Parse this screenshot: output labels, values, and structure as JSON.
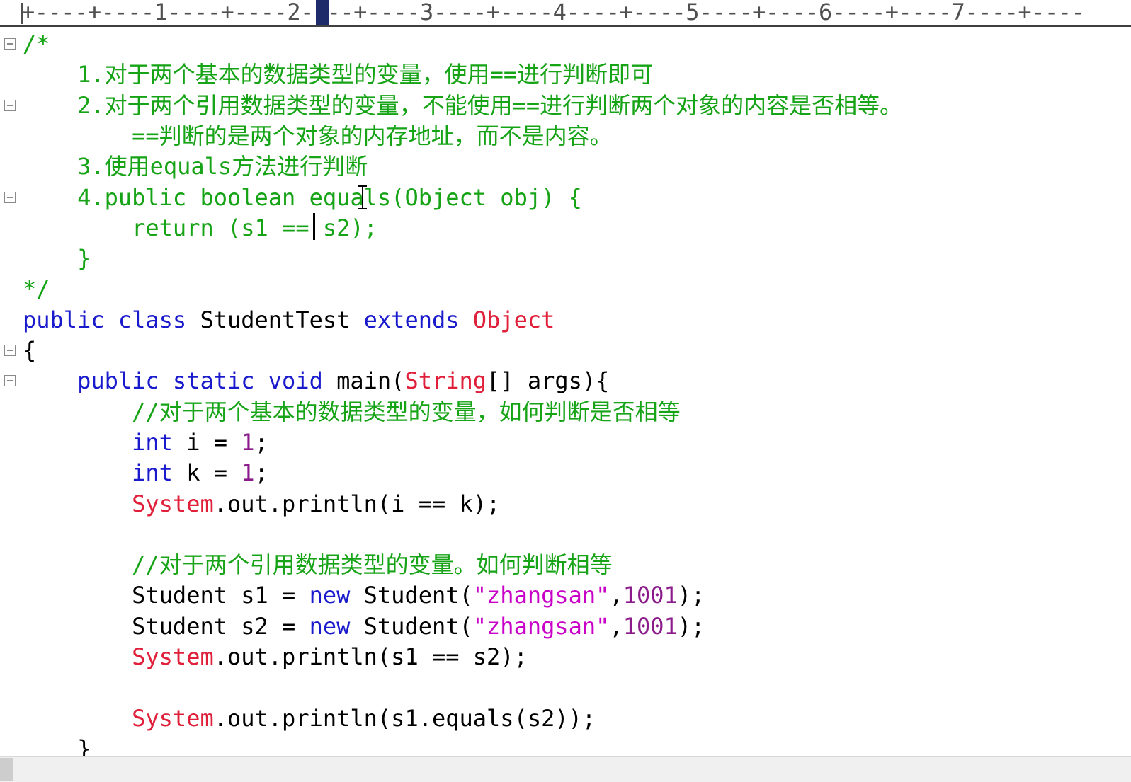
{
  "ruler": {
    "text": "+----+----1----+----2----+----3----+----4----+----5----+----6----+----7----+----"
  },
  "lines": [
    [
      {
        "t": "/*",
        "c": "cmt"
      }
    ],
    [
      {
        "t": "    1.对于两个基本的数据类型的变量，使用==进行判断即可",
        "c": "cmt"
      }
    ],
    [
      {
        "t": "    2.对于两个引用数据类型的变量，不能使用==进行判断两个对象的内容是否相等。",
        "c": "cmt"
      }
    ],
    [
      {
        "t": "        ==判断的是两个对象的内存地址，而不是内容。",
        "c": "cmt"
      }
    ],
    [
      {
        "t": "    3.使用equals方法进行判断",
        "c": "cmt"
      }
    ],
    [
      {
        "t": "    4.public boolean equals(Object obj) {",
        "c": "cmt"
      }
    ],
    [
      {
        "t": "        return (s1 == s2);",
        "c": "cmt"
      }
    ],
    [
      {
        "t": "    }",
        "c": "cmt"
      }
    ],
    [
      {
        "t": "*/",
        "c": "cmt"
      }
    ],
    [
      {
        "t": "public",
        "c": "kw"
      },
      {
        "t": " ",
        "c": "plain"
      },
      {
        "t": "class",
        "c": "kw"
      },
      {
        "t": " StudentTest ",
        "c": "plain"
      },
      {
        "t": "extends",
        "c": "kw"
      },
      {
        "t": " ",
        "c": "plain"
      },
      {
        "t": "Object",
        "c": "cls"
      }
    ],
    [
      {
        "t": "{",
        "c": "plain"
      }
    ],
    [
      {
        "t": "    ",
        "c": "plain"
      },
      {
        "t": "public",
        "c": "kw"
      },
      {
        "t": " ",
        "c": "plain"
      },
      {
        "t": "static",
        "c": "kw"
      },
      {
        "t": " ",
        "c": "plain"
      },
      {
        "t": "void",
        "c": "kw"
      },
      {
        "t": " main(",
        "c": "plain"
      },
      {
        "t": "String",
        "c": "cls"
      },
      {
        "t": "[] args){",
        "c": "plain"
      }
    ],
    [
      {
        "t": "        //对于两个基本的数据类型的变量，如何判断是否相等",
        "c": "cmt"
      }
    ],
    [
      {
        "t": "        ",
        "c": "plain"
      },
      {
        "t": "int",
        "c": "kw"
      },
      {
        "t": " i = ",
        "c": "plain"
      },
      {
        "t": "1",
        "c": "num"
      },
      {
        "t": ";",
        "c": "plain"
      }
    ],
    [
      {
        "t": "        ",
        "c": "plain"
      },
      {
        "t": "int",
        "c": "kw"
      },
      {
        "t": " k = ",
        "c": "plain"
      },
      {
        "t": "1",
        "c": "num"
      },
      {
        "t": ";",
        "c": "plain"
      }
    ],
    [
      {
        "t": "        ",
        "c": "plain"
      },
      {
        "t": "System",
        "c": "cls"
      },
      {
        "t": ".out.println(i == k);",
        "c": "plain"
      }
    ],
    [
      {
        "t": "",
        "c": "plain"
      }
    ],
    [
      {
        "t": "        //对于两个引用数据类型的变量。如何判断相等",
        "c": "cmt"
      }
    ],
    [
      {
        "t": "        Student s1 = ",
        "c": "plain"
      },
      {
        "t": "new",
        "c": "kw"
      },
      {
        "t": " Student(",
        "c": "plain"
      },
      {
        "t": "\"zhangsan\"",
        "c": "str"
      },
      {
        "t": ",",
        "c": "plain"
      },
      {
        "t": "1001",
        "c": "num"
      },
      {
        "t": ");",
        "c": "plain"
      }
    ],
    [
      {
        "t": "        Student s2 = ",
        "c": "plain"
      },
      {
        "t": "new",
        "c": "kw"
      },
      {
        "t": " Student(",
        "c": "plain"
      },
      {
        "t": "\"zhangsan\"",
        "c": "str"
      },
      {
        "t": ",",
        "c": "plain"
      },
      {
        "t": "1001",
        "c": "num"
      },
      {
        "t": ");",
        "c": "plain"
      }
    ],
    [
      {
        "t": "        ",
        "c": "plain"
      },
      {
        "t": "System",
        "c": "cls"
      },
      {
        "t": ".out.println(s1 == s2);",
        "c": "plain"
      }
    ],
    [
      {
        "t": "",
        "c": "plain"
      }
    ],
    [
      {
        "t": "        ",
        "c": "plain"
      },
      {
        "t": "System",
        "c": "cls"
      },
      {
        "t": ".out.println(s1.equals(s2));",
        "c": "plain"
      }
    ],
    [
      {
        "t": "    }",
        "c": "plain"
      }
    ]
  ],
  "folds": [
    0,
    2,
    5,
    10,
    11
  ]
}
